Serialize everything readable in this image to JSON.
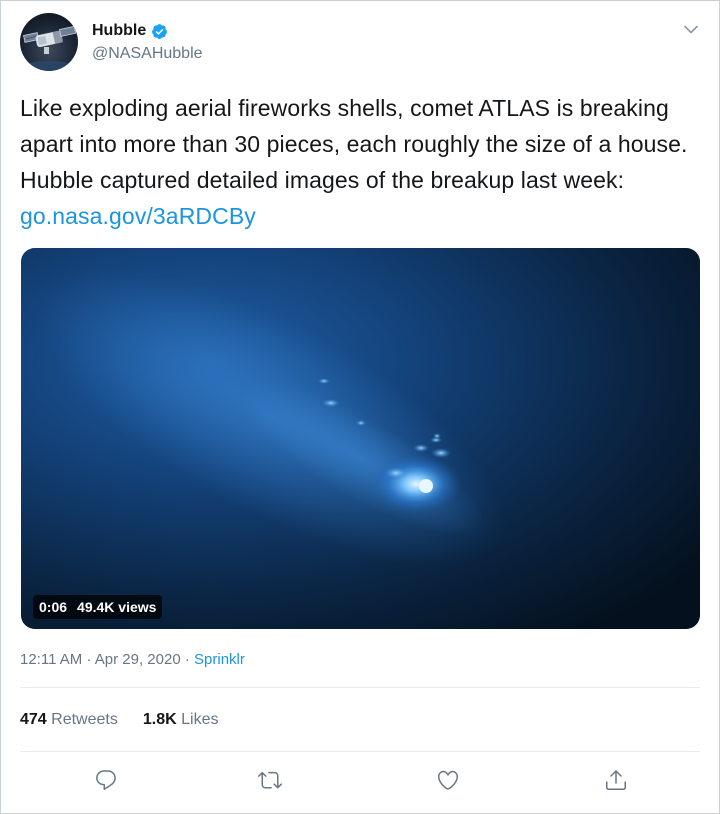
{
  "author": {
    "display_name": "Hubble",
    "handle": "@NASAHubble",
    "avatar_icon": "hubble-telescope-icon",
    "verified_icon": "verified-badge-icon"
  },
  "tweet": {
    "text": "Like exploding aerial fireworks shells, comet ATLAS is breaking apart into more than 30 pieces, each roughly the size of a house. Hubble captured detailed images of the breakup last week: ",
    "link_text": "go.nasa.gov/3aRDCBy"
  },
  "media": {
    "duration": "0:06",
    "views": "49.4K views"
  },
  "meta": {
    "time": "12:11 AM",
    "separator": "·",
    "date": "Apr 29, 2020",
    "source": "Sprinklr"
  },
  "stats": {
    "retweets_count": "474",
    "retweets_label": "Retweets",
    "likes_count": "1.8K",
    "likes_label": "Likes"
  },
  "actions": {
    "icons": [
      "reply-icon",
      "retweet-icon",
      "like-icon",
      "share-icon"
    ]
  },
  "colors": {
    "link": "#1b95e0",
    "secondary_text": "#657786",
    "primary_text": "#14171a",
    "verified": "#1da1f2"
  }
}
